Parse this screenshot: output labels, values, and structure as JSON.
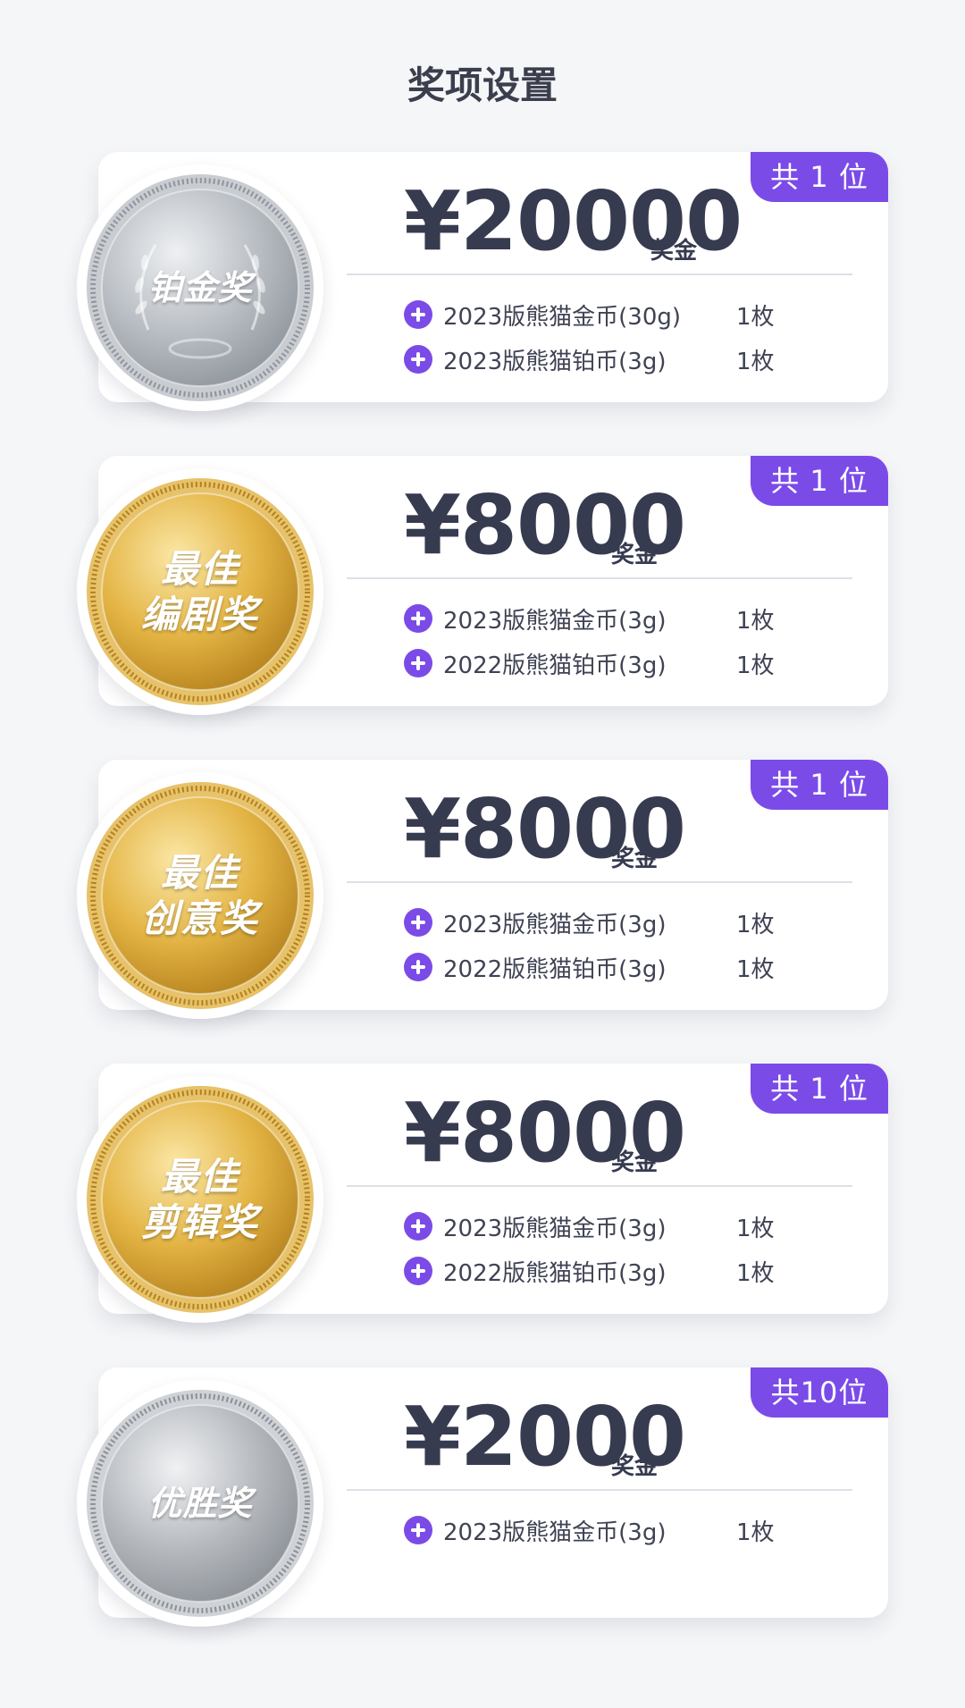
{
  "page": {
    "title": "奖项设置"
  },
  "colors": {
    "accent": "#7b4be8",
    "text_dark": "#373b50",
    "gold": "#d9a62c",
    "silver": "#a9adb2",
    "background": "#f5f6f8"
  },
  "awards": [
    {
      "medal_text": [
        "铂金奖"
      ],
      "medal_style": "platinum",
      "amount": "¥20000",
      "unit": "奖金",
      "count": "共 1 位",
      "extras": [
        {
          "name": "2023版熊猫金币(30g)",
          "qty": "1枚"
        },
        {
          "name": "2023版熊猫铂币(3g)",
          "qty": "1枚"
        }
      ]
    },
    {
      "medal_text": [
        "最佳",
        "编剧奖"
      ],
      "medal_style": "gold",
      "amount": "¥8000",
      "unit": "奖金",
      "count": "共 1 位",
      "extras": [
        {
          "name": "2023版熊猫金币(3g)",
          "qty": "1枚"
        },
        {
          "name": "2022版熊猫铂币(3g)",
          "qty": "1枚"
        }
      ]
    },
    {
      "medal_text": [
        "最佳",
        "创意奖"
      ],
      "medal_style": "gold",
      "amount": "¥8000",
      "unit": "奖金",
      "count": "共 1 位",
      "extras": [
        {
          "name": "2023版熊猫金币(3g)",
          "qty": "1枚"
        },
        {
          "name": "2022版熊猫铂币(3g)",
          "qty": "1枚"
        }
      ]
    },
    {
      "medal_text": [
        "最佳",
        "剪辑奖"
      ],
      "medal_style": "gold",
      "amount": "¥8000",
      "unit": "奖金",
      "count": "共 1 位",
      "extras": [
        {
          "name": "2023版熊猫金币(3g)",
          "qty": "1枚"
        },
        {
          "name": "2022版熊猫铂币(3g)",
          "qty": "1枚"
        }
      ]
    },
    {
      "medal_text": [
        "优胜奖"
      ],
      "medal_style": "silver",
      "amount": "¥2000",
      "unit": "奖金",
      "count": "共10位",
      "extras": [
        {
          "name": "2023版熊猫金币(3g)",
          "qty": "1枚"
        }
      ]
    }
  ]
}
